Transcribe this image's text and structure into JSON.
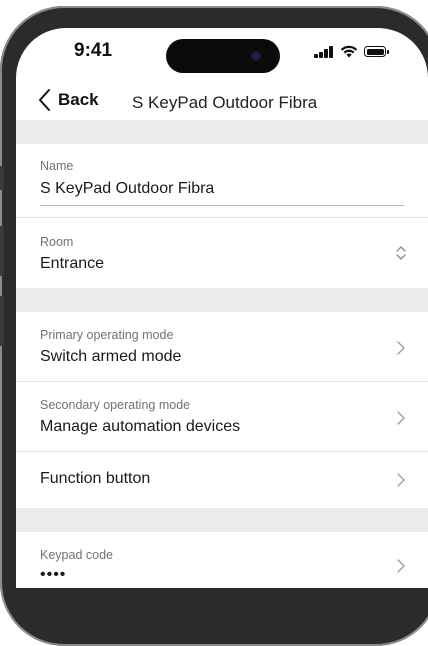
{
  "status_bar": {
    "time": "9:41"
  },
  "nav": {
    "back_label": "Back",
    "title": "S KeyPad Outdoor Fibra"
  },
  "fields": {
    "name": {
      "label": "Name",
      "value": "S KeyPad Outdoor Fibra"
    },
    "room": {
      "label": "Room",
      "value": "Entrance"
    },
    "primary_mode": {
      "label": "Primary operating mode",
      "value": "Switch armed mode"
    },
    "secondary_mode": {
      "label": "Secondary operating mode",
      "value": "Manage automation devices"
    },
    "function_button": {
      "label": "Function button"
    },
    "keypad_code": {
      "label": "Keypad code",
      "value": "••••"
    }
  },
  "icons": {
    "back": "chevron-left-icon",
    "disclosure": "chevron-right-icon",
    "picker": "up-down-chevron-icon"
  }
}
